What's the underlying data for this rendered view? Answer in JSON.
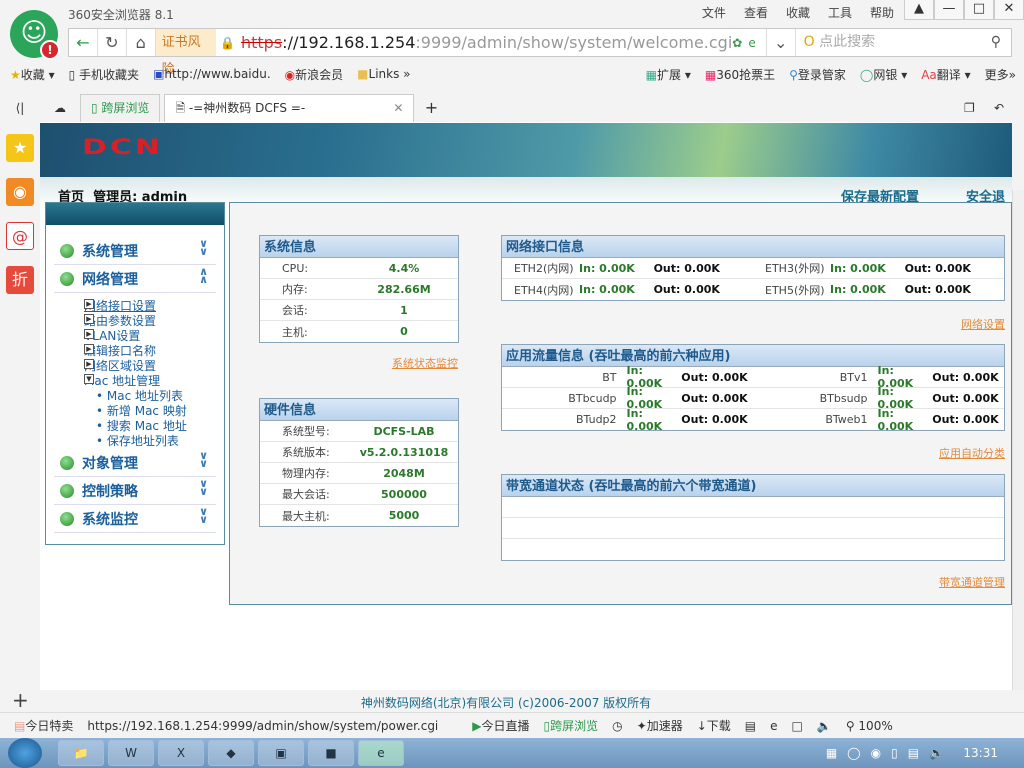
{
  "browser": {
    "title": "360安全浏览器 8.1",
    "menu": [
      "文件",
      "查看",
      "收藏",
      "工具",
      "帮助"
    ],
    "cert_risk": "证书风险",
    "url_scheme": "https",
    "url_host": "://192.168.1.254",
    "url_rest": ":9999/admin/show/system/welcome.cgi",
    "search_placeholder": "点此搜索",
    "bookmarks": [
      "收藏",
      "手机收藏夹",
      "http://www.baidu.",
      "新浪会员",
      "Links"
    ],
    "bookmarks_right": [
      "扩展",
      "360抢票王",
      "登录管家",
      "网银",
      "翻译",
      "更多"
    ],
    "tabs": {
      "cross_screen": "跨屏浏览",
      "active": "-=神州数码 DCFS =-"
    },
    "status_bar": {
      "today_deal": "今日特卖",
      "link_url": "https://192.168.1.254:9999/admin/show/system/power.cgi",
      "live": "今日直播",
      "cross": "跨屏浏览",
      "accelerator": "加速器",
      "download": "下载",
      "zoom": "100%"
    },
    "clock": "13:31"
  },
  "page": {
    "logo": "DCN",
    "home": "首页",
    "admin_label": "管理员: admin",
    "save_config": "保存最新配置",
    "logout": "安全退出",
    "nav": [
      {
        "label": "系统管理",
        "expanded": false
      },
      {
        "label": "网络管理",
        "expanded": true,
        "children": [
          "网络接口设置",
          "路由参数设置",
          "VLAN设置",
          "编辑接口名称",
          "网络区域设置",
          "Mac 地址管理"
        ],
        "mac_children": [
          "Mac 地址列表",
          "新增 Mac 映射",
          "搜索 Mac 地址",
          "保存地址列表"
        ]
      },
      {
        "label": "对象管理",
        "expanded": false
      },
      {
        "label": "控制策略",
        "expanded": false
      },
      {
        "label": "系统监控",
        "expanded": false
      }
    ],
    "sysinfo": {
      "title": "系统信息",
      "rows": [
        [
          "CPU:",
          "4.4%"
        ],
        [
          "内存:",
          "282.66M"
        ],
        [
          "会话:",
          "1"
        ],
        [
          "主机:",
          "0"
        ]
      ],
      "link": "系统状态监控"
    },
    "hwinfo": {
      "title": "硬件信息",
      "rows": [
        [
          "系统型号:",
          "DCFS-LAB"
        ],
        [
          "系统版本:",
          "v5.2.0.131018"
        ],
        [
          "物理内存:",
          "2048M"
        ],
        [
          "最大会话:",
          "500000"
        ],
        [
          "最大主机:",
          "5000"
        ]
      ]
    },
    "netif": {
      "title": "网络接口信息",
      "rows": [
        [
          {
            "name": "ETH2(内网)",
            "in": "In: 0.00K",
            "out": "Out: 0.00K"
          },
          {
            "name": "ETH3(外网)",
            "in": "In: 0.00K",
            "out": "Out: 0.00K"
          }
        ],
        [
          {
            "name": "ETH4(内网)",
            "in": "In: 0.00K",
            "out": "Out: 0.00K"
          },
          {
            "name": "ETH5(外网)",
            "in": "In: 0.00K",
            "out": "Out: 0.00K"
          }
        ]
      ],
      "link": "网络设置"
    },
    "apps": {
      "title": "应用流量信息 (吞吐最高的前六种应用)",
      "rows": [
        [
          {
            "name": "BT",
            "in": "In: 0.00K",
            "out": "Out: 0.00K"
          },
          {
            "name": "BTv1",
            "in": "In: 0.00K",
            "out": "Out: 0.00K"
          }
        ],
        [
          {
            "name": "BTbcudp",
            "in": "In: 0.00K",
            "out": "Out: 0.00K"
          },
          {
            "name": "BTbsudp",
            "in": "In: 0.00K",
            "out": "Out: 0.00K"
          }
        ],
        [
          {
            "name": "BTudp2",
            "in": "In: 0.00K",
            "out": "Out: 0.00K"
          },
          {
            "name": "BTweb1",
            "in": "In: 0.00K",
            "out": "Out: 0.00K"
          }
        ]
      ],
      "link": "应用自动分类"
    },
    "bandwidth": {
      "title": "带宽通道状态 (吞吐最高的前六个带宽通道)",
      "link": "带宽通道管理"
    },
    "footer": "神州数码网络(北京)有限公司 (c)2006-2007 版权所有"
  }
}
